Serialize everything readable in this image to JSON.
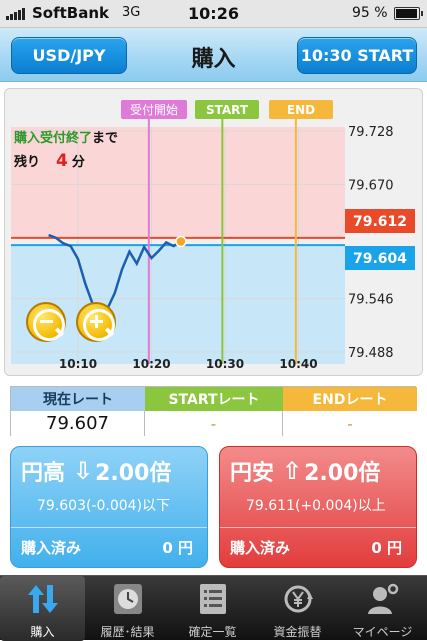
{
  "status_bar": {
    "carrier": "SoftBank",
    "network": "3G",
    "time": "10:26",
    "battery": "95 %"
  },
  "nav": {
    "pair_button": "USD/JPY",
    "title": "購入",
    "start_button": "10:30 START"
  },
  "chart": {
    "markers": {
      "accept_start": "受付開始",
      "start": "START",
      "end": "END"
    },
    "info_line1_prefix": "購入受付終了",
    "info_line1_suffix": "まで",
    "info_line2_label": "残り",
    "info_line2_value": "4",
    "info_line2_unit": "分",
    "y_ticks": [
      "79.728",
      "79.670",
      "79.546",
      "79.488"
    ],
    "high_rate_label": "79.612",
    "low_rate_label": "79.604",
    "x_ticks": [
      "10:10",
      "10:20",
      "10:30",
      "10:40"
    ],
    "colors": {
      "high_zone": "#fbd6d6",
      "low_zone": "#c7e7f8",
      "high_line": "#e84a2a",
      "low_line": "#1aa3e8",
      "accept_line": "#e07ad8",
      "start_line": "#8cc63f",
      "end_line": "#f5b83a",
      "price_line": "#1a5fb0"
    }
  },
  "chart_data": {
    "type": "line",
    "x": [
      "10:06",
      "10:07",
      "10:08",
      "10:09",
      "10:10",
      "10:11",
      "10:12",
      "10:13",
      "10:14",
      "10:15",
      "10:16",
      "10:17",
      "10:18",
      "10:19",
      "10:20",
      "10:21",
      "10:22",
      "10:23",
      "10:24"
    ],
    "series": [
      {
        "values": [
          79.615,
          79.612,
          79.606,
          79.603,
          79.589,
          79.562,
          79.54,
          79.525,
          79.535,
          79.552,
          79.578,
          79.597,
          79.584,
          79.602,
          79.59,
          79.598,
          79.607,
          79.603,
          79.608
        ]
      }
    ],
    "ylim": [
      79.488,
      79.728
    ],
    "reference_lines": {
      "high": 79.612,
      "low": 79.604
    },
    "grid": true
  },
  "rates": {
    "headers": [
      "現在レート",
      "STARTレート",
      "ENDレート"
    ],
    "values": [
      "79.607",
      "-",
      "-"
    ]
  },
  "cards": {
    "high": {
      "label": "円高",
      "arrow": "⇩",
      "multiplier": "2.00倍",
      "threshold": "79.603(-0.004)以下",
      "bought_label": "購入済み",
      "bought_value": "0 円"
    },
    "low": {
      "label": "円安",
      "arrow": "⇧",
      "multiplier": "2.00倍",
      "threshold": "79.611(+0.004)以上",
      "bought_label": "購入済み",
      "bought_value": "0 円"
    }
  },
  "tabs": [
    {
      "label": "購入",
      "icon": "up-down-arrows-icon"
    },
    {
      "label": "履歴･結果",
      "icon": "clock-icon"
    },
    {
      "label": "確定一覧",
      "icon": "list-icon"
    },
    {
      "label": "資金振替",
      "icon": "yen-transfer-icon"
    },
    {
      "label": "マイページ",
      "icon": "user-gear-icon"
    }
  ]
}
